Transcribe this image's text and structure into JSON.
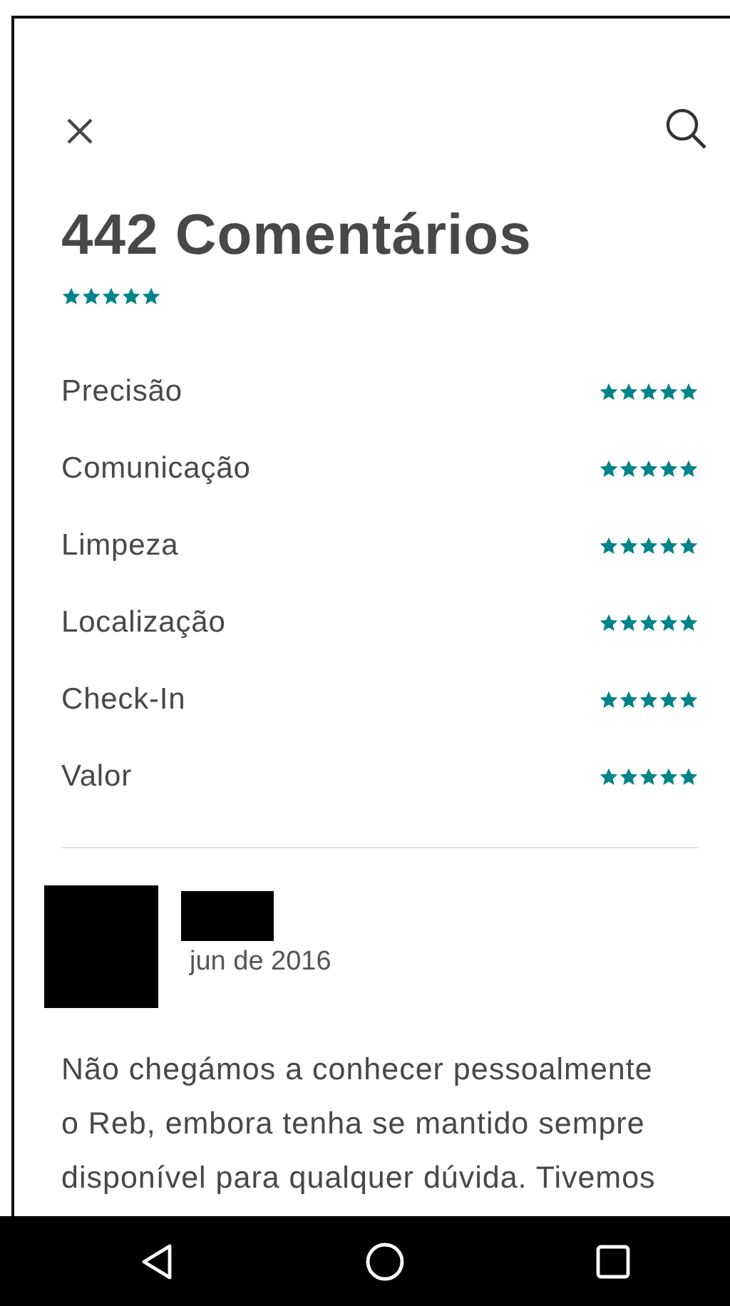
{
  "title": "442 Comentários",
  "overall": {
    "stars": 5
  },
  "categories": [
    {
      "label": "Precisão",
      "stars": 5
    },
    {
      "label": "Comunicação",
      "stars": 5
    },
    {
      "label": "Limpeza",
      "stars": 5
    },
    {
      "label": "Localização",
      "stars": 5
    },
    {
      "label": "Check-In",
      "stars": 5
    },
    {
      "label": "Valor",
      "stars": 5
    }
  ],
  "review": {
    "date": "jun de 2016",
    "text": "Não chegámos a conhecer pessoalmente o Reb, embora tenha se mantido sempre disponível para qualquer dúvida. Tivemos"
  }
}
